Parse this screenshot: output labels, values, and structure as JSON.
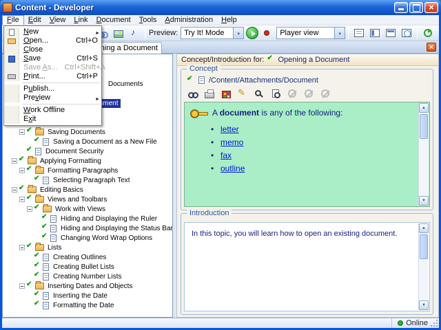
{
  "window": {
    "title": "Content - Developer"
  },
  "colors": {
    "selection": "#22339b",
    "concept_bg": "#a9eec6",
    "link": "#0014d8",
    "navy": "#141c82",
    "online_green": "#28b428"
  },
  "menubar": {
    "items": [
      {
        "label": "File",
        "key": "F",
        "open": true
      },
      {
        "label": "Edit",
        "key": "E"
      },
      {
        "label": "View",
        "key": "V"
      },
      {
        "label": "Link",
        "key": "L"
      },
      {
        "label": "Document",
        "key": "D"
      },
      {
        "label": "Tools",
        "key": "T"
      },
      {
        "label": "Administration",
        "key": "A"
      },
      {
        "label": "Help",
        "key": "H"
      }
    ]
  },
  "file_menu": {
    "items": [
      {
        "label": "New",
        "key": "N",
        "icon": "new-document-icon",
        "submenu": true
      },
      {
        "label": "Open...",
        "key": "O",
        "shortcut": "Ctrl+O",
        "icon": "open-folder-icon"
      },
      {
        "label": "Close",
        "key": "C"
      },
      {
        "label": "Save",
        "key": "S",
        "shortcut": "Ctrl+S",
        "icon": "save-icon"
      },
      {
        "label": "Save As...",
        "key": "A",
        "shortcut": "Ctrl+Shift+A",
        "disabled": true
      },
      {
        "label": "Print...",
        "key": "P",
        "shortcut": "Ctrl+P",
        "icon": "print-icon"
      },
      {
        "separator": true
      },
      {
        "label": "Publish...",
        "key": "u"
      },
      {
        "label": "Preview",
        "key": "v",
        "submenu": true
      },
      {
        "separator": true
      },
      {
        "label": "Work Offline",
        "key": "W"
      },
      {
        "label": "Exit",
        "key": "x"
      }
    ]
  },
  "toolbar": {
    "left_icons": [
      "new-document-icon",
      "open-folder-icon",
      "save-icon",
      "print-icon"
    ],
    "mid_icons": [
      "spellcheck-icon",
      "link-icon",
      "image-icon",
      "sound-icon"
    ],
    "preview_label": "Preview:",
    "preview_mode": "Try It! Mode",
    "record_icons": [
      "record-icon"
    ],
    "view_mode": "Player view",
    "view_toggle_icons": [
      "document-view-icon",
      "player-view-icon",
      "outline-view-icon",
      "web-view-icon"
    ],
    "end_icons": [
      "refresh-icon",
      "help-icon"
    ]
  },
  "tabstrip": {
    "active_tab": {
      "label": "Opening a Document"
    }
  },
  "tree": {
    "rows": [
      {
        "i": 2,
        "label": "Documents",
        "partial": true
      },
      {
        "i": 4,
        "level": 3,
        "type": "topic",
        "label": "Opening a Document",
        "selected": true
      },
      {
        "i": 7,
        "level": 2,
        "type": "folder",
        "expanded": true,
        "label": "Saving Documents"
      },
      {
        "i": 8,
        "level": 3,
        "type": "topic",
        "label": "Saving a Document as a New File"
      },
      {
        "i": 9,
        "level": 2,
        "type": "topic",
        "label": "Document Security"
      },
      {
        "i": 10,
        "level": 1,
        "type": "folder",
        "expanded": true,
        "label": "Applying Formatting"
      },
      {
        "i": 11,
        "level": 2,
        "type": "folder",
        "expanded": true,
        "label": "Formatting Paragraphs"
      },
      {
        "i": 12,
        "level": 3,
        "type": "topic",
        "label": "Selecting Paragraph Text"
      },
      {
        "i": 13,
        "level": 1,
        "type": "folder",
        "expanded": true,
        "label": "Editing Basics"
      },
      {
        "i": 14,
        "level": 2,
        "type": "folder",
        "expanded": true,
        "label": "Views and Toolbars"
      },
      {
        "i": 15,
        "level": 3,
        "type": "folder",
        "expanded": true,
        "label": "Work with Views"
      },
      {
        "i": 16,
        "level": 4,
        "type": "topic",
        "label": "Hiding and Displaying the Ruler"
      },
      {
        "i": 17,
        "level": 4,
        "type": "topic",
        "label": "Hiding and Displaying the Status Bar"
      },
      {
        "i": 18,
        "level": 4,
        "type": "topic",
        "label": "Changing Word Wrap Options"
      },
      {
        "i": 19,
        "level": 2,
        "type": "folder",
        "expanded": true,
        "label": "Lists"
      },
      {
        "i": 20,
        "level": 3,
        "type": "topic",
        "label": "Creating Outlines"
      },
      {
        "i": 21,
        "level": 3,
        "type": "topic",
        "label": "Creating Bullet Lists"
      },
      {
        "i": 22,
        "level": 3,
        "type": "topic",
        "label": "Creating Number Lists"
      },
      {
        "i": 23,
        "level": 2,
        "type": "folder",
        "expanded": true,
        "label": "Inserting Dates and Objects"
      },
      {
        "i": 24,
        "level": 3,
        "type": "topic",
        "label": "Inserting the Date"
      },
      {
        "i": 25,
        "level": 3,
        "type": "topic",
        "label": "Formatting the Date"
      }
    ]
  },
  "content": {
    "header": {
      "prefix": "Concept/Introduction for:",
      "topic": "Opening a Document"
    },
    "concept": {
      "title": "Concept",
      "path": "/Content/Attachments/Document",
      "toolbar_icons": [
        "glasses-icon",
        "print-icon",
        "palette-icon",
        "edit-icon",
        "zoom-icon",
        "find-icon"
      ],
      "disabled_icons": [
        "play-sound-icon",
        "record-sound-icon",
        "stop-sound-icon"
      ],
      "sentence": {
        "before": "A ",
        "bold": "document",
        "after": " is any of the following:"
      },
      "links": [
        "letter",
        "memo",
        "fax",
        "outline"
      ]
    },
    "introduction": {
      "title": "Introduction",
      "text": "In this topic, you will learn how to open an existing document."
    }
  },
  "statusbar": {
    "online": "Online"
  }
}
